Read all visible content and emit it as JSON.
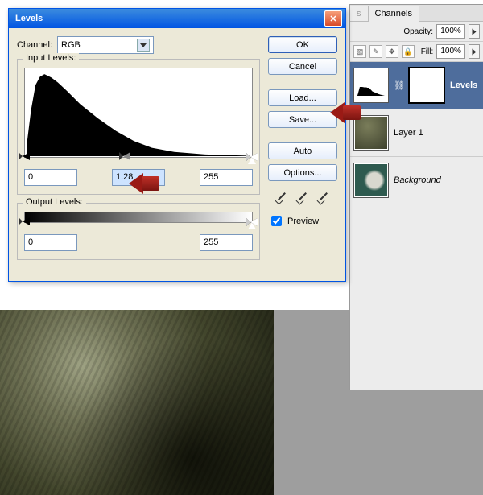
{
  "dialog": {
    "title": "Levels",
    "channel_label": "Channel:",
    "channel_value": "RGB",
    "input_label": "Input Levels:",
    "input_black": "0",
    "input_gamma": "1.28",
    "input_white": "255",
    "output_label": "Output Levels:",
    "output_black": "0",
    "output_white": "255",
    "buttons": {
      "ok": "OK",
      "cancel": "Cancel",
      "load": "Load...",
      "save": "Save...",
      "auto": "Auto",
      "options": "Options..."
    },
    "preview_label": "Preview",
    "preview_checked": true
  },
  "layers_panel": {
    "tabs": {
      "hidden": "s",
      "active": "Channels"
    },
    "opacity_label": "Opacity:",
    "opacity_value": "100%",
    "fill_label": "Fill:",
    "fill_value": "100%",
    "layers": [
      {
        "name": "Levels",
        "selected": true
      },
      {
        "name": "Layer 1",
        "selected": false
      },
      {
        "name": "Background",
        "selected": false,
        "italic": true
      }
    ]
  }
}
